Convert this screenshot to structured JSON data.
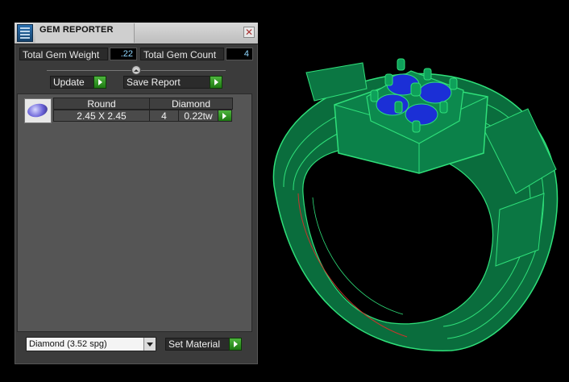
{
  "window": {
    "title": "GEM REPORTER",
    "close_icon": "close-icon"
  },
  "summary": {
    "total_gem_weight_label": "Total Gem Weight",
    "total_gem_weight_value": ".22",
    "total_gem_count_label": "Total Gem Count",
    "total_gem_count_value": "4"
  },
  "actions": {
    "update_label": "Update",
    "save_report_label": "Save Report"
  },
  "gem_table": {
    "headers": [
      "Round",
      "Diamond"
    ],
    "rows": [
      {
        "size": "2.45 X 2.45",
        "count": "4",
        "weight": "0.22tw"
      }
    ]
  },
  "material": {
    "selected": "Diamond     (3.52 spg)",
    "set_material_label": "Set Material"
  },
  "colors": {
    "ring_fill": "#0a7a45",
    "ring_wire": "#2fe07a",
    "gem_blue": "#1b2fd6"
  }
}
